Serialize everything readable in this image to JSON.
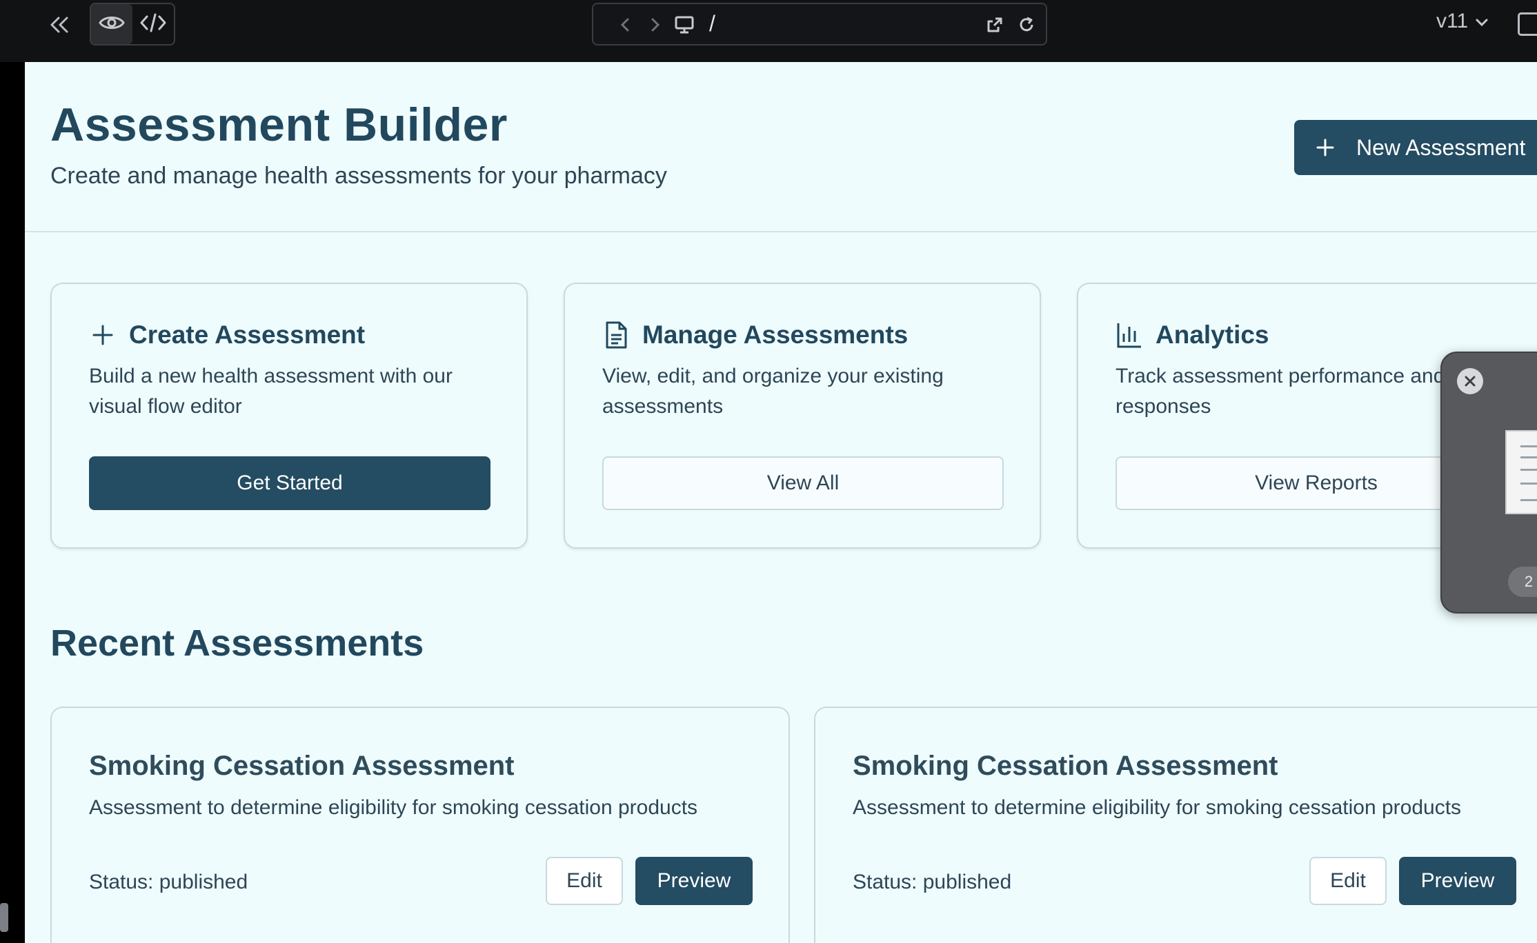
{
  "toolbar": {
    "url_path": "/",
    "version": "v11"
  },
  "header": {
    "title": "Assessment Builder",
    "subtitle": "Create and manage health assessments for your pharmacy",
    "new_button_label": "New Assessment"
  },
  "action_cards": [
    {
      "icon": "plus-icon",
      "title": "Create Assessment",
      "description": "Build a new health assessment with our visual flow editor",
      "button_label": "Get Started"
    },
    {
      "icon": "document-icon",
      "title": "Manage Assessments",
      "description": "View, edit, and organize your existing assessments",
      "button_label": "View All"
    },
    {
      "icon": "bar-chart-icon",
      "title": "Analytics",
      "description": "Track assessment performance and user responses",
      "button_label": "View Reports"
    }
  ],
  "recent": {
    "section_title": "Recent Assessments",
    "items": [
      {
        "title": "Smoking Cessation Assessment",
        "description": "Assessment to determine eligibility for smoking cessation products",
        "status": "Status: published",
        "edit_label": "Edit",
        "preview_label": "Preview"
      },
      {
        "title": "Smoking Cessation Assessment",
        "description": "Assessment to determine eligibility for smoking cessation products",
        "status": "Status: published",
        "edit_label": "Edit",
        "preview_label": "Preview"
      }
    ]
  },
  "overlay": {
    "count": "2"
  },
  "colors": {
    "primary": "#244c62",
    "background": "#effcfd",
    "toolbar": "#111214"
  }
}
